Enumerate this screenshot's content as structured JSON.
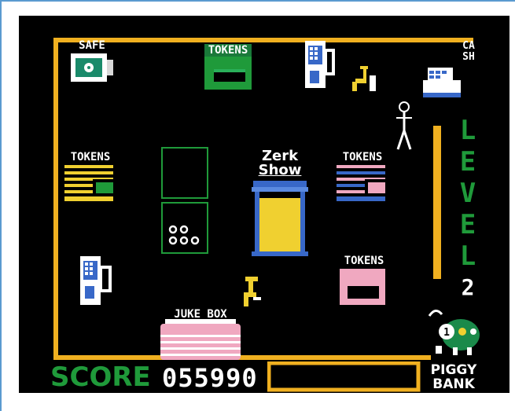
{
  "screen": {
    "background": "#000000",
    "border_color": "#f0b020"
  },
  "stations": {
    "safe_label": "SAFE",
    "tokens_top_label": "TOKENS",
    "tokens_left_label": "TOKENS",
    "tokens_right_label": "TOKENS",
    "tokens_lower_right_label": "TOKENS",
    "cash_label": "CASH",
    "jukebox_label": "JUKE BOX",
    "zerk_show_line1": "Zerk",
    "zerk_show_line2": "Show"
  },
  "level": {
    "letters": [
      "L",
      "E",
      "V",
      "E",
      "L"
    ],
    "number": "2"
  },
  "hud": {
    "score_label": "SCORE",
    "score_value": "055990",
    "piggy_line1": "PIGGY",
    "piggy_line2": "BANK",
    "piggy_coin": "1"
  },
  "colors": {
    "green": "#1f9a3a",
    "yellow": "#f0d030",
    "orange": "#f0b020",
    "pink": "#f0a8c0",
    "blue": "#3868c8",
    "white": "#ffffff",
    "teal": "#28b090"
  }
}
